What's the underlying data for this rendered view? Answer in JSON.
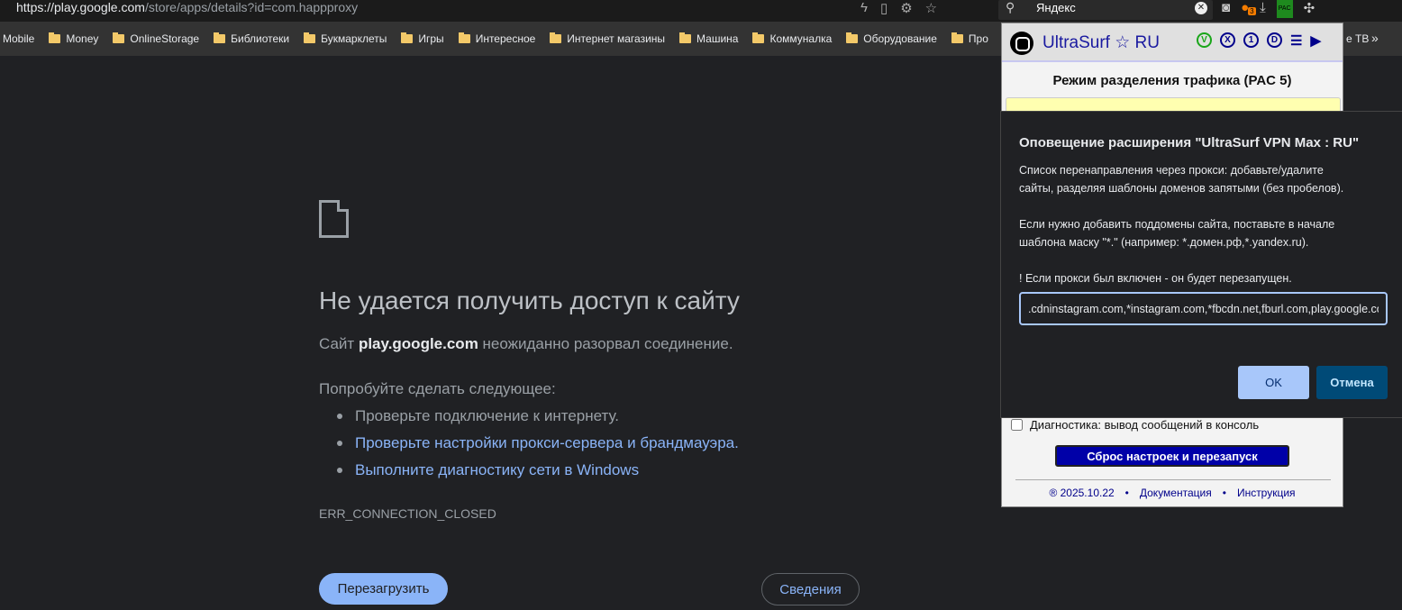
{
  "browser": {
    "url_host": "https://play.google.com",
    "url_path": "/store/apps/details?id=com.happproxy",
    "search_value": "Яндекс",
    "ext_badge": "3",
    "pac_label": "PAC",
    "bookmarks": [
      "Mobile",
      "Money",
      "OnlineStorage",
      "Библиотеки",
      "Букмарклеты",
      "Игры",
      "Интересное",
      "Интернет магазины",
      "Машина",
      "Коммуналка",
      "Оборудование",
      "Про"
    ],
    "bookmark_tail": "е ТВ",
    "more": "»"
  },
  "error_page": {
    "title": "Не удается получить доступ к сайту",
    "msg_prefix": "Сайт ",
    "msg_host": "play.google.com",
    "msg_suffix": " неожиданно разорвал соединение.",
    "try": "Попробуйте сделать следующее:",
    "suggestions": [
      "Проверьте подключение к интернету.",
      "Проверьте настройки прокси-сервера и брандмауэра.",
      "Выполните диагностику сети в Windows"
    ],
    "code": "ERR_CONNECTION_CLOSED",
    "reload": "Перезагрузить",
    "details": "Сведения"
  },
  "popup": {
    "title": "UltraSurf ☆ RU",
    "icons": [
      "V",
      "X",
      "1",
      "D"
    ],
    "mode": "Режим разделения трафика (PAC 5)",
    "diag": "Диагностика: вывод сообщений в консоль",
    "reset": "Сброс настроек и перезапуск",
    "version": "® 2025.10.22",
    "docs": "Документация",
    "guide": "Инструкция",
    "sep": "•"
  },
  "dialog": {
    "title": "Оповещение расширения \"UltraSurf VPN Max : RU\"",
    "message": "Список перенаправления через прокси: добавьте/удалите\nсайты, разделяя шаблоны доменов запятыми (без пробелов).\n\nЕсли нужно добавить поддомены сайта, поставьте в начале\nшаблона маску \"*.\" (например: *.домен.рф,*.yandex.ru).\n\n! Если прокси был включен - он будет перезапущен.",
    "input_value": ".cdninstagram.com,*instagram.com,*fbcdn.net,fburl.com,play.google.com",
    "ok": "OK",
    "cancel": "Отмена"
  }
}
